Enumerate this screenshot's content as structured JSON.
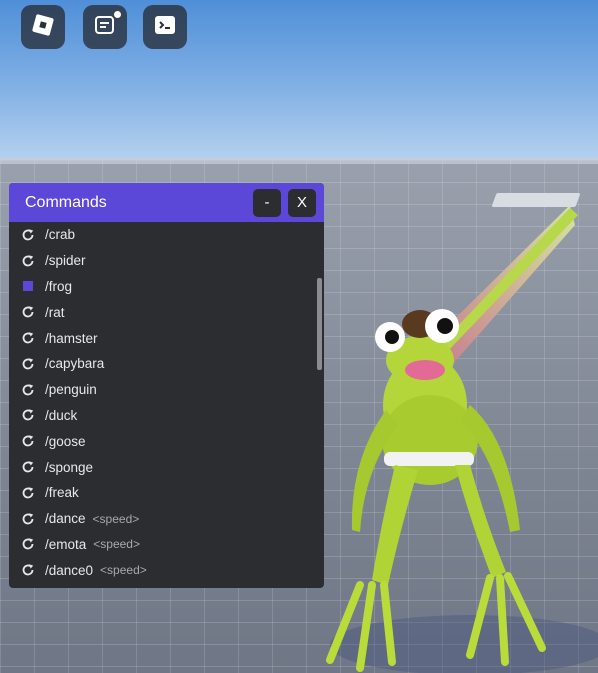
{
  "topbar": {
    "buttons": [
      {
        "name": "roblox-menu",
        "icon": "roblox-logo-icon"
      },
      {
        "name": "chat",
        "icon": "chat-icon",
        "has_notification": true
      },
      {
        "name": "console",
        "icon": "terminal-icon"
      }
    ]
  },
  "panel": {
    "title": "Commands",
    "minimize_label": "-",
    "close_label": "X",
    "accent_color": "#5b48d8",
    "commands": [
      {
        "name": "/crab",
        "icon": "refresh-icon",
        "arg": ""
      },
      {
        "name": "/spider",
        "icon": "refresh-icon",
        "arg": ""
      },
      {
        "name": "/frog",
        "icon": "stop-square-icon",
        "arg": ""
      },
      {
        "name": "/rat",
        "icon": "refresh-icon",
        "arg": ""
      },
      {
        "name": "/hamster",
        "icon": "refresh-icon",
        "arg": ""
      },
      {
        "name": "/capybara",
        "icon": "refresh-icon",
        "arg": ""
      },
      {
        "name": "/penguin",
        "icon": "refresh-icon",
        "arg": ""
      },
      {
        "name": "/duck",
        "icon": "refresh-icon",
        "arg": ""
      },
      {
        "name": "/goose",
        "icon": "refresh-icon",
        "arg": ""
      },
      {
        "name": "/sponge",
        "icon": "refresh-icon",
        "arg": ""
      },
      {
        "name": "/freak",
        "icon": "refresh-icon",
        "arg": ""
      },
      {
        "name": "/dance",
        "icon": "refresh-icon",
        "arg": "<speed>"
      },
      {
        "name": "/emota",
        "icon": "refresh-icon",
        "arg": "<speed>"
      },
      {
        "name": "/dance0",
        "icon": "refresh-icon",
        "arg": "<speed>"
      }
    ]
  }
}
